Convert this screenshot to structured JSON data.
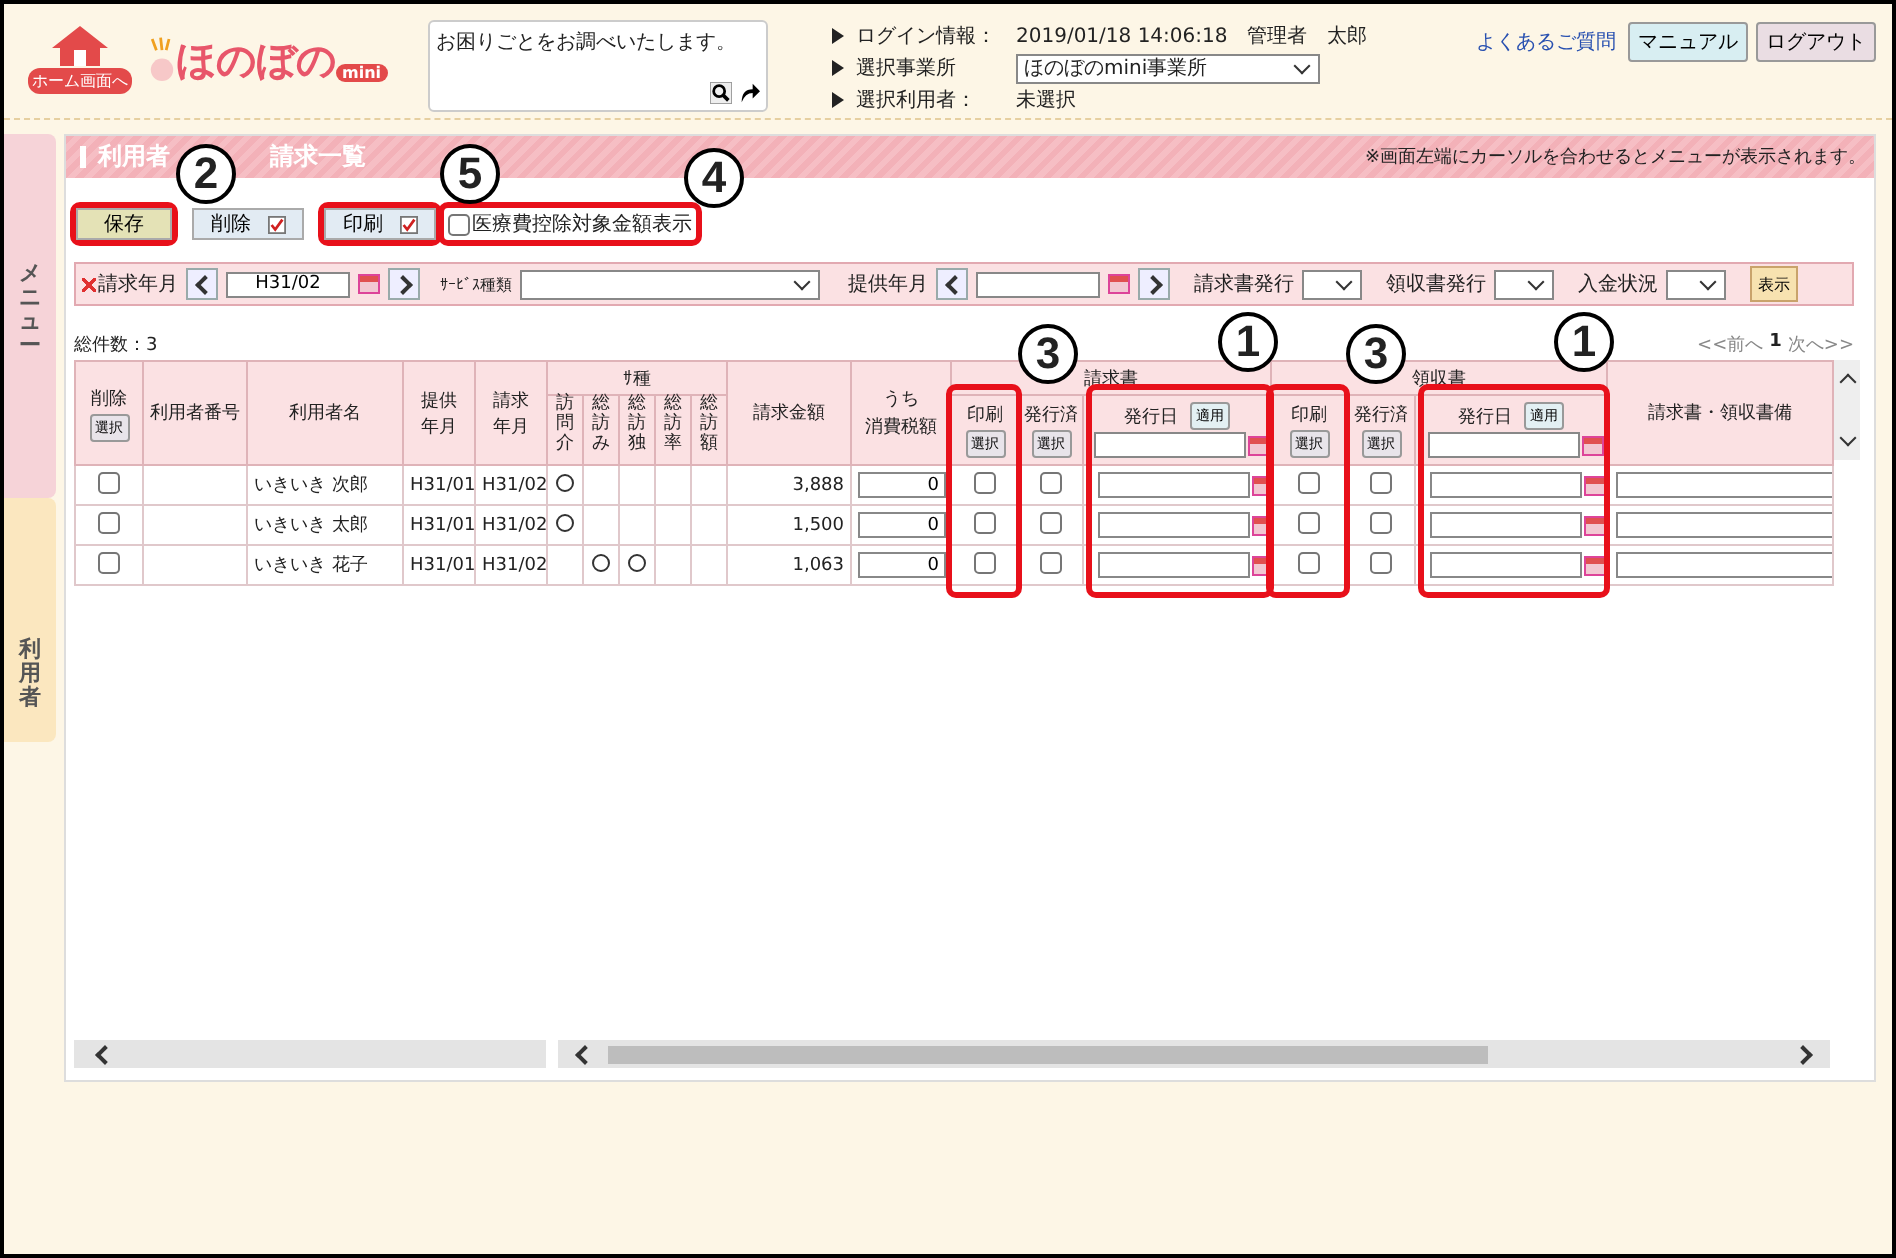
{
  "header": {
    "home_label": "ホーム画面へ",
    "logo_text": "ほのぼの",
    "logo_badge": "mini",
    "help_box": {
      "placeholder": "お困りごとをお調べいたします。"
    },
    "info": [
      {
        "label": "ログイン情報：",
        "value": "2019/01/18 14:06:18　管理者　太郎",
        "kind": "text"
      },
      {
        "label": "選択事業所",
        "value": "ほのぼのmini事業所",
        "kind": "select"
      },
      {
        "label": "選択利用者：",
        "value": "未選択",
        "kind": "text"
      }
    ],
    "faq_link": "よくあるご質問",
    "buttons": [
      {
        "label": "マニュアル",
        "color": "#d8eef2"
      },
      {
        "label": "ログアウト",
        "color": "#eadde3"
      }
    ]
  },
  "side_tabs": [
    {
      "label": "メニュー",
      "color": "#f6d3d8"
    },
    {
      "label": "利用者",
      "color": "#fbe7bf"
    }
  ],
  "panel": {
    "title_parts": [
      "利用者",
      "請求一覧"
    ],
    "notice": "※画面左端にカーソルを合わせるとメニューが表示されます。",
    "toolbar": [
      {
        "label": "保存",
        "kind": "save",
        "callout": "2"
      },
      {
        "label": "削除",
        "kind": "check"
      },
      {
        "label": "印刷",
        "kind": "check",
        "callout": "5"
      }
    ],
    "option": {
      "label": "医療費控除対象金額表示",
      "checked": false,
      "callout": "4"
    },
    "filters": {
      "bill_month": {
        "label": "請求年月",
        "value": "H31/02"
      },
      "service_type": {
        "label": "ｻｰﾋﾞｽ種類"
      },
      "provide_month": {
        "label": "提供年月"
      },
      "selects": [
        {
          "label": "請求書発行"
        },
        {
          "label": "領収書発行"
        },
        {
          "label": "入金状況"
        }
      ],
      "show_button": "表示"
    },
    "total": "総件数：3",
    "pager": {
      "prev": "<<前へ",
      "page": "1",
      "next": "次へ>>"
    }
  },
  "table": {
    "columns": {
      "delete": {
        "label": "削除",
        "button": "選択"
      },
      "number": "利用者番号",
      "name": "利用者名",
      "provide": "提供年月",
      "bill": "請求年月",
      "service_group": "ｻ種",
      "services": [
        "訪問介",
        "総訪み",
        "総訪独",
        "総訪率",
        "総訪額"
      ],
      "amount": "請求金額",
      "tax_top": "うち",
      "tax": "消費税額",
      "note": "請求書・領収書備"
    },
    "groups": [
      {
        "label": "請求書",
        "print": {
          "label": "印刷",
          "button": "選択",
          "callout": "3"
        },
        "issued": {
          "label": "発行済",
          "button": "選択"
        },
        "date": {
          "label": "発行日",
          "button": "適用",
          "callout": "1"
        }
      },
      {
        "label": "領収書",
        "print": {
          "label": "印刷",
          "button": "選択",
          "callout": "3"
        },
        "issued": {
          "label": "発行済",
          "button": "選択"
        },
        "date": {
          "label": "発行日",
          "button": "適用",
          "callout": "1"
        }
      }
    ],
    "rows": [
      {
        "delete": false,
        "name": "いきいき 次郎",
        "provide": "H31/01",
        "bill": "H31/02",
        "services": [
          true,
          false,
          false,
          false,
          false
        ],
        "amount": "3,888",
        "tax": "0",
        "flags": [
          {
            "print": false,
            "issued": false
          },
          {
            "print": false,
            "issued": false
          }
        ]
      },
      {
        "delete": false,
        "name": "いきいき 太郎",
        "provide": "H31/01",
        "bill": "H31/02",
        "services": [
          true,
          false,
          false,
          false,
          false
        ],
        "amount": "1,500",
        "tax": "0",
        "flags": [
          {
            "print": false,
            "issued": false
          },
          {
            "print": false,
            "issued": false
          }
        ]
      },
      {
        "delete": false,
        "name": "いきいき 花子",
        "provide": "H31/01",
        "bill": "H31/02",
        "services": [
          false,
          true,
          true,
          false,
          false
        ],
        "amount": "1,063",
        "tax": "0",
        "flags": [
          {
            "print": false,
            "issued": false
          },
          {
            "print": false,
            "issued": false
          }
        ]
      }
    ]
  }
}
